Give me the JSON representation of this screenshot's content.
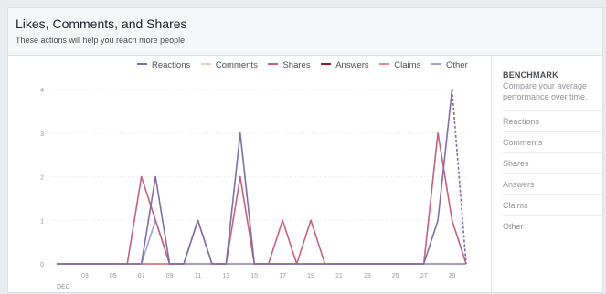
{
  "header": {
    "title": "Likes, Comments, and Shares",
    "subtitle": "These actions will help you reach more people."
  },
  "sidebar": {
    "title": "BENCHMARK",
    "description": "Compare your average performance over time.",
    "items": [
      {
        "label": "Reactions"
      },
      {
        "label": "Comments"
      },
      {
        "label": "Shares"
      },
      {
        "label": "Answers"
      },
      {
        "label": "Claims"
      },
      {
        "label": "Other"
      }
    ]
  },
  "chart_data": {
    "type": "line",
    "month_label": "DEC",
    "xlabel": "",
    "ylabel": "",
    "ylim": [
      0,
      4
    ],
    "yticks": [
      0,
      1,
      2,
      3,
      4
    ],
    "x": [
      1,
      2,
      3,
      4,
      5,
      6,
      7,
      8,
      9,
      10,
      11,
      12,
      13,
      14,
      15,
      16,
      17,
      18,
      19,
      20,
      21,
      22,
      23,
      24,
      25,
      26,
      27,
      28,
      29,
      30
    ],
    "xtick_labels": [
      "03",
      "05",
      "07",
      "09",
      "11",
      "13",
      "15",
      "17",
      "19",
      "21",
      "23",
      "25",
      "27",
      "29"
    ],
    "xtick_values": [
      3,
      5,
      7,
      9,
      11,
      13,
      15,
      17,
      19,
      21,
      23,
      25,
      27,
      29
    ],
    "legend_position": "top",
    "grid": "horizontal dotted",
    "series": [
      {
        "name": "Reactions",
        "color": "#7f6ea8",
        "values": [
          0,
          0,
          0,
          0,
          0,
          0,
          0,
          2,
          0,
          0,
          1,
          0,
          0,
          3,
          0,
          0,
          0,
          0,
          0,
          0,
          0,
          0,
          0,
          0,
          0,
          0,
          0,
          1,
          4,
          0
        ],
        "dashed_last_segment": true
      },
      {
        "name": "Comments",
        "color": "#f5c5c2",
        "values": [
          0,
          0,
          0,
          0,
          0,
          0,
          0,
          0,
          0,
          0,
          0,
          0,
          0,
          0,
          0,
          0,
          0,
          0,
          0,
          0,
          0,
          0,
          0,
          0,
          0,
          0,
          0,
          0,
          0,
          0
        ]
      },
      {
        "name": "Shares",
        "color": "#c7607a",
        "values": [
          0,
          0,
          0,
          0,
          0,
          0,
          2,
          1,
          0,
          0,
          1,
          0,
          0,
          2,
          0,
          0,
          1,
          0,
          1,
          0,
          0,
          0,
          0,
          0,
          0,
          0,
          0,
          3,
          1,
          0
        ]
      },
      {
        "name": "Answers",
        "color": "#8b1a2b",
        "values": [
          0,
          0,
          0,
          0,
          0,
          0,
          0,
          0,
          0,
          0,
          0,
          0,
          0,
          0,
          0,
          0,
          0,
          0,
          0,
          0,
          0,
          0,
          0,
          0,
          0,
          0,
          0,
          0,
          0,
          0
        ]
      },
      {
        "name": "Claims",
        "color": "#e48a8a",
        "values": [
          0,
          0,
          0,
          0,
          0,
          0,
          0,
          0,
          0,
          0,
          0,
          0,
          0,
          0,
          0,
          0,
          0,
          0,
          0,
          0,
          0,
          0,
          0,
          0,
          0,
          0,
          0,
          0,
          0,
          0
        ]
      },
      {
        "name": "Other",
        "color": "#9aa6d6",
        "values": [
          0,
          0,
          0,
          0,
          0,
          0,
          0,
          1,
          0,
          0,
          0,
          0,
          0,
          0,
          0,
          0,
          0,
          0,
          0,
          0,
          0,
          0,
          0,
          0,
          0,
          0,
          0,
          0,
          0,
          0
        ]
      }
    ]
  }
}
